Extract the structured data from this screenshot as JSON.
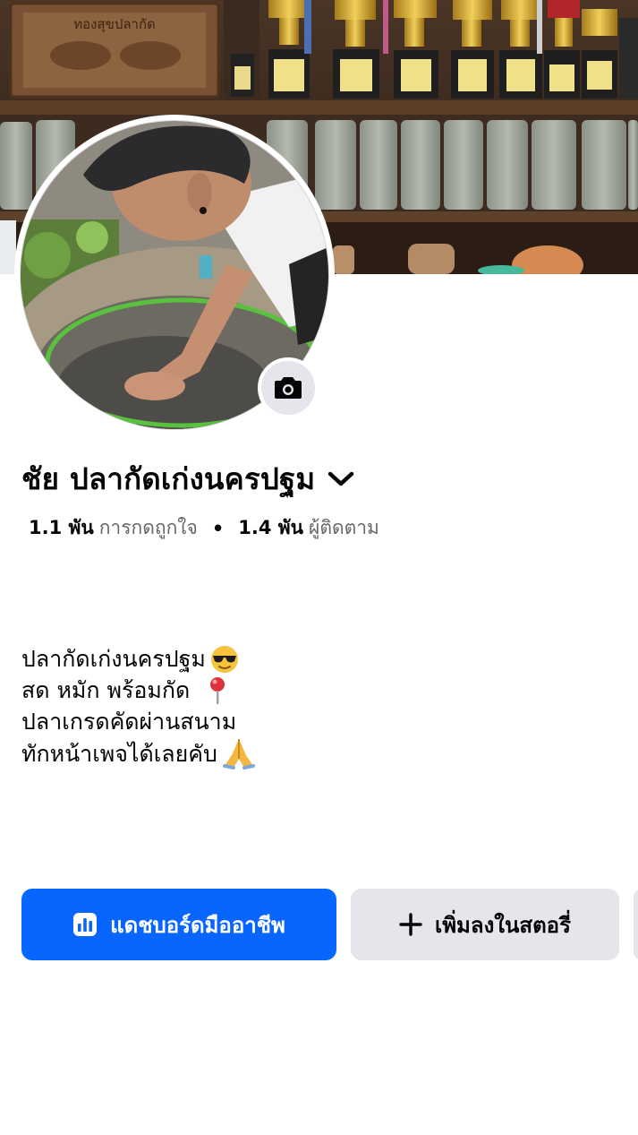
{
  "profile": {
    "name": "ชัย ปลากัดเก่งนครปฐม",
    "likes_count": "1.1 พัน",
    "likes_label": "การกดถูกใจ",
    "separator": "•",
    "followers_count": "1.4 พัน",
    "followers_label": "ผู้ติดตาม"
  },
  "cover": {
    "sign_text": "ทองสุขปลากัด"
  },
  "bio": {
    "lines": [
      {
        "text": "ปลากัดเก่งนครปฐม",
        "emoji": "sunglasses-emoji"
      },
      {
        "text": "สด หมัก พร้อมกัด",
        "emoji": "round-pushpin-emoji"
      },
      {
        "text": "ปลาเกรดคัดผ่านสนาม",
        "emoji": ""
      },
      {
        "text": "ทักหน้าเพจได้เลยคับ",
        "emoji": "folded-hands-emoji"
      }
    ]
  },
  "actions": {
    "dashboard_label": "แดชบอร์ดมืออาชีพ",
    "add_story_label": "เพิ่มลงในสตอรี่"
  },
  "colors": {
    "primary": "#0866ff",
    "secondary_button": "#e4e6eb",
    "muted_text": "#65676b",
    "text": "#050505"
  },
  "icons": {
    "camera": "camera-icon",
    "chevron": "chevron-down-icon",
    "dashboard": "bar-chart-icon",
    "add": "plus-icon"
  }
}
